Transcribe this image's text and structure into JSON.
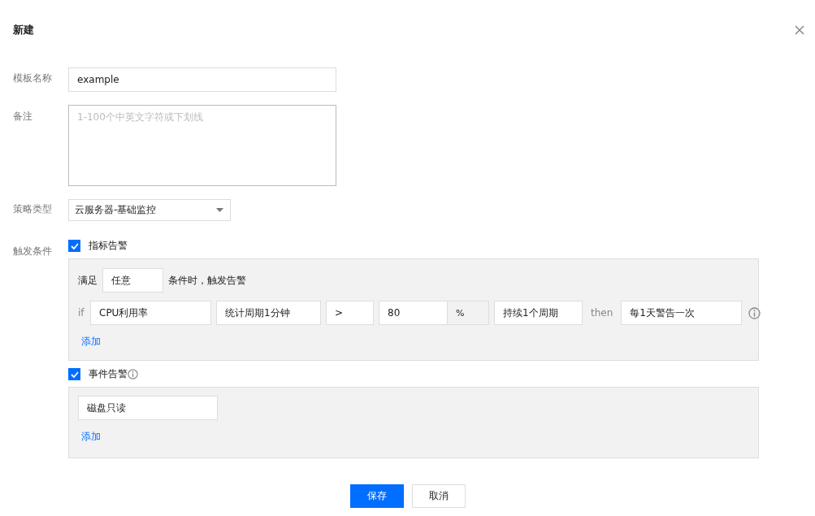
{
  "dialog": {
    "title": "新建"
  },
  "form": {
    "template_name": {
      "label": "模板名称",
      "value": "example"
    },
    "remark": {
      "label": "备注",
      "placeholder": "1-100个中英文字符或下划线"
    },
    "policy_type": {
      "label": "策略类型",
      "value": "云服务器-基础监控"
    },
    "trigger": {
      "label": "触发条件",
      "metric_alarm": {
        "label": "指标告警",
        "checked": true,
        "prefix": "满足",
        "match": "任意",
        "suffix": "条件时，触发告警",
        "rules": [
          {
            "if": "if",
            "metric": "CPU利用率",
            "period": "统计周期1分钟",
            "operator": ">",
            "threshold": "80",
            "unit": "%",
            "duration": "持续1个周期",
            "then": "then",
            "action": "每1天警告一次"
          }
        ],
        "add_link": "添加"
      },
      "event_alarm": {
        "label": "事件告警",
        "checked": true,
        "events": [
          "磁盘只读"
        ],
        "add_link": "添加"
      }
    }
  },
  "buttons": [
    {
      "label": "保存",
      "kind": "primary"
    },
    {
      "label": "取消",
      "kind": "secondary"
    }
  ]
}
